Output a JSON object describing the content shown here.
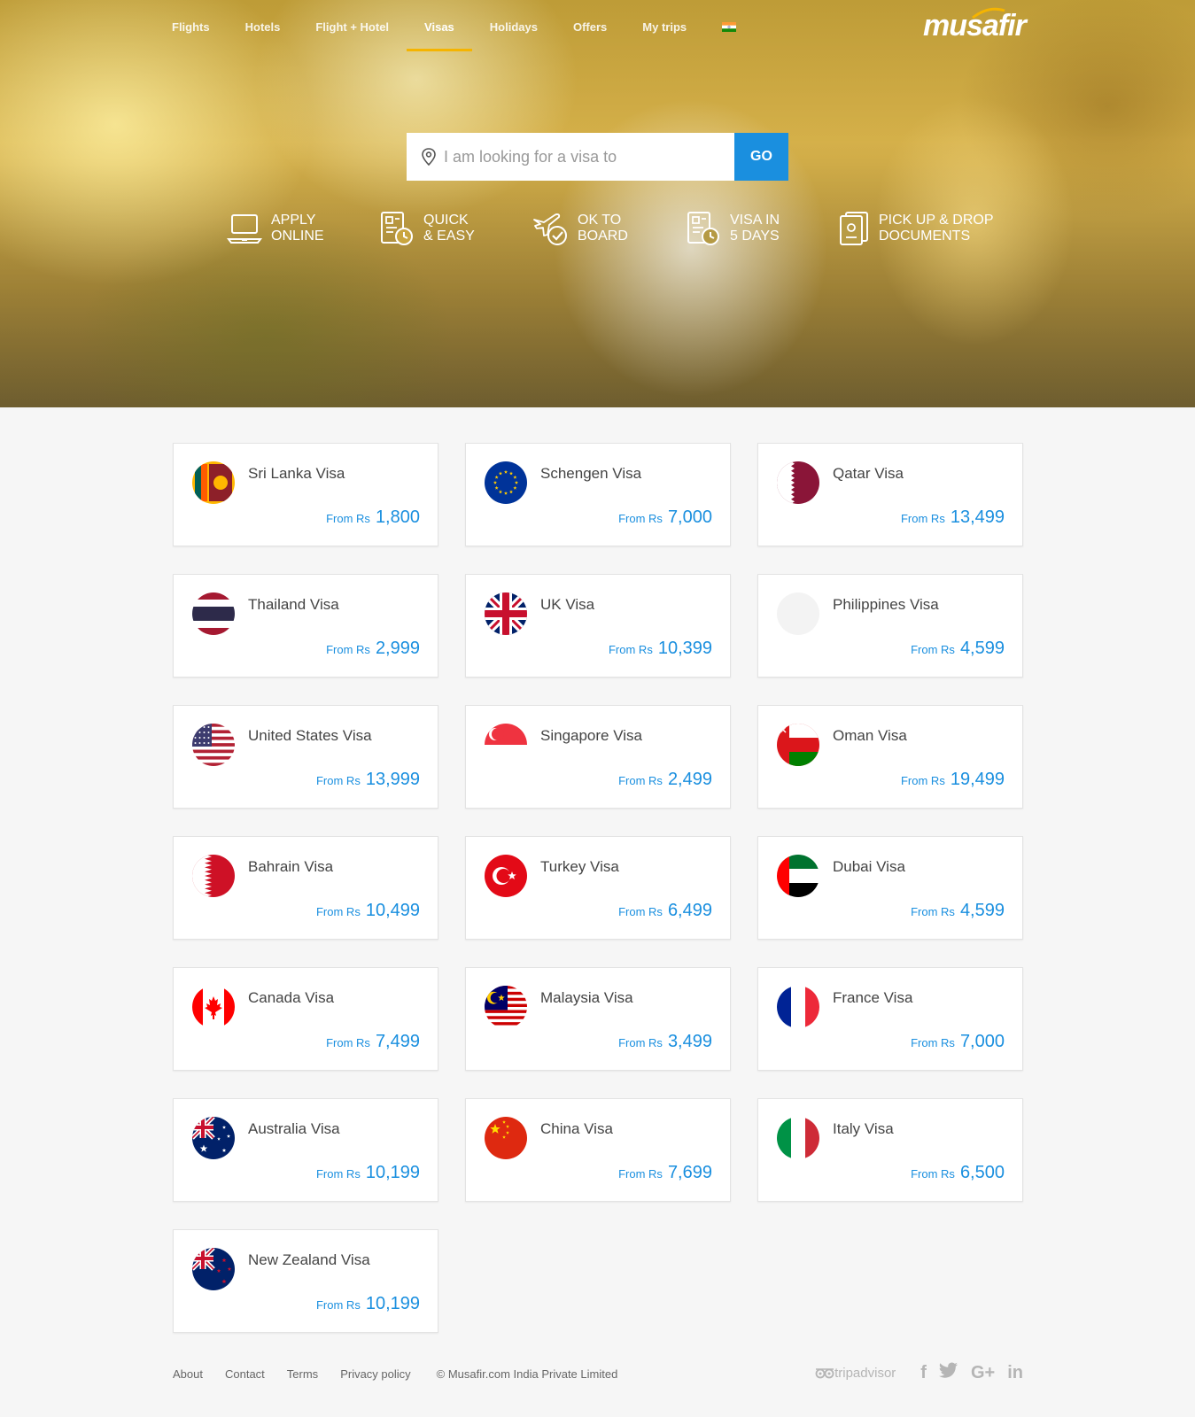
{
  "nav": {
    "items": [
      {
        "label": "Flights",
        "active": false
      },
      {
        "label": "Hotels",
        "active": false
      },
      {
        "label": "Flight + Hotel",
        "active": false
      },
      {
        "label": "Visas",
        "active": true
      },
      {
        "label": "Holidays",
        "active": false
      },
      {
        "label": "Offers",
        "active": false
      },
      {
        "label": "My trips",
        "active": false
      }
    ],
    "country_flag": "india-flag-icon"
  },
  "brand": {
    "logo": "musafir"
  },
  "search": {
    "placeholder": "I am looking for a visa to",
    "value": "",
    "go_label": "GO"
  },
  "features": [
    {
      "icon": "laptop-icon",
      "label": "APPLY\nONLINE"
    },
    {
      "icon": "document-clock-icon",
      "label": "QUICK\n& EASY"
    },
    {
      "icon": "plane-check-icon",
      "label": "OK TO\nBOARD"
    },
    {
      "icon": "document-clock-icon",
      "label": "VISA IN\n5 DAYS"
    },
    {
      "icon": "passport-icon",
      "label": "PICK UP & DROP\nDOCUMENTS"
    }
  ],
  "visas": [
    {
      "name": "Sri Lanka Visa",
      "from": "From Rs",
      "amount": "1,800",
      "flag": "srilanka"
    },
    {
      "name": "Schengen Visa",
      "from": "From Rs",
      "amount": "7,000",
      "flag": "eu"
    },
    {
      "name": "Qatar Visa",
      "from": "From Rs",
      "amount": "13,499",
      "flag": "qatar"
    },
    {
      "name": "Thailand Visa",
      "from": "From Rs",
      "amount": "2,999",
      "flag": "thailand"
    },
    {
      "name": "UK Visa",
      "from": "From Rs",
      "amount": "10,399",
      "flag": "uk"
    },
    {
      "name": "Philippines Visa",
      "from": "From Rs",
      "amount": "4,599",
      "flag": "blank"
    },
    {
      "name": "United States Visa",
      "from": "From Rs",
      "amount": "13,999",
      "flag": "usa"
    },
    {
      "name": "Singapore Visa",
      "from": "From Rs",
      "amount": "2,499",
      "flag": "singapore"
    },
    {
      "name": "Oman Visa",
      "from": "From Rs",
      "amount": "19,499",
      "flag": "oman"
    },
    {
      "name": "Bahrain Visa",
      "from": "From Rs",
      "amount": "10,499",
      "flag": "bahrain"
    },
    {
      "name": "Turkey Visa",
      "from": "From Rs",
      "amount": "6,499",
      "flag": "turkey"
    },
    {
      "name": "Dubai Visa",
      "from": "From Rs",
      "amount": "4,599",
      "flag": "uae"
    },
    {
      "name": "Canada Visa",
      "from": "From Rs",
      "amount": "7,499",
      "flag": "canada"
    },
    {
      "name": "Malaysia Visa",
      "from": "From Rs",
      "amount": "3,499",
      "flag": "malaysia"
    },
    {
      "name": "France Visa",
      "from": "From Rs",
      "amount": "7,000",
      "flag": "france"
    },
    {
      "name": "Australia Visa",
      "from": "From Rs",
      "amount": "10,199",
      "flag": "australia"
    },
    {
      "name": "China Visa",
      "from": "From Rs",
      "amount": "7,699",
      "flag": "china"
    },
    {
      "name": "Italy Visa",
      "from": "From Rs",
      "amount": "6,500",
      "flag": "italy"
    },
    {
      "name": "New Zealand Visa",
      "from": "From Rs",
      "amount": "10,199",
      "flag": "newzealand"
    }
  ],
  "footer": {
    "links": [
      "About",
      "Contact",
      "Terms",
      "Privacy policy"
    ],
    "copyright": "© Musafir.com India Private Limited",
    "tripadvisor": "tripadvisor",
    "social": [
      "f",
      "twitter-icon",
      "G+",
      "in"
    ]
  },
  "colors": {
    "accent": "#1a8fdf",
    "nav_active_underline": "#f5b400",
    "page_bg": "#f6f6f6"
  }
}
